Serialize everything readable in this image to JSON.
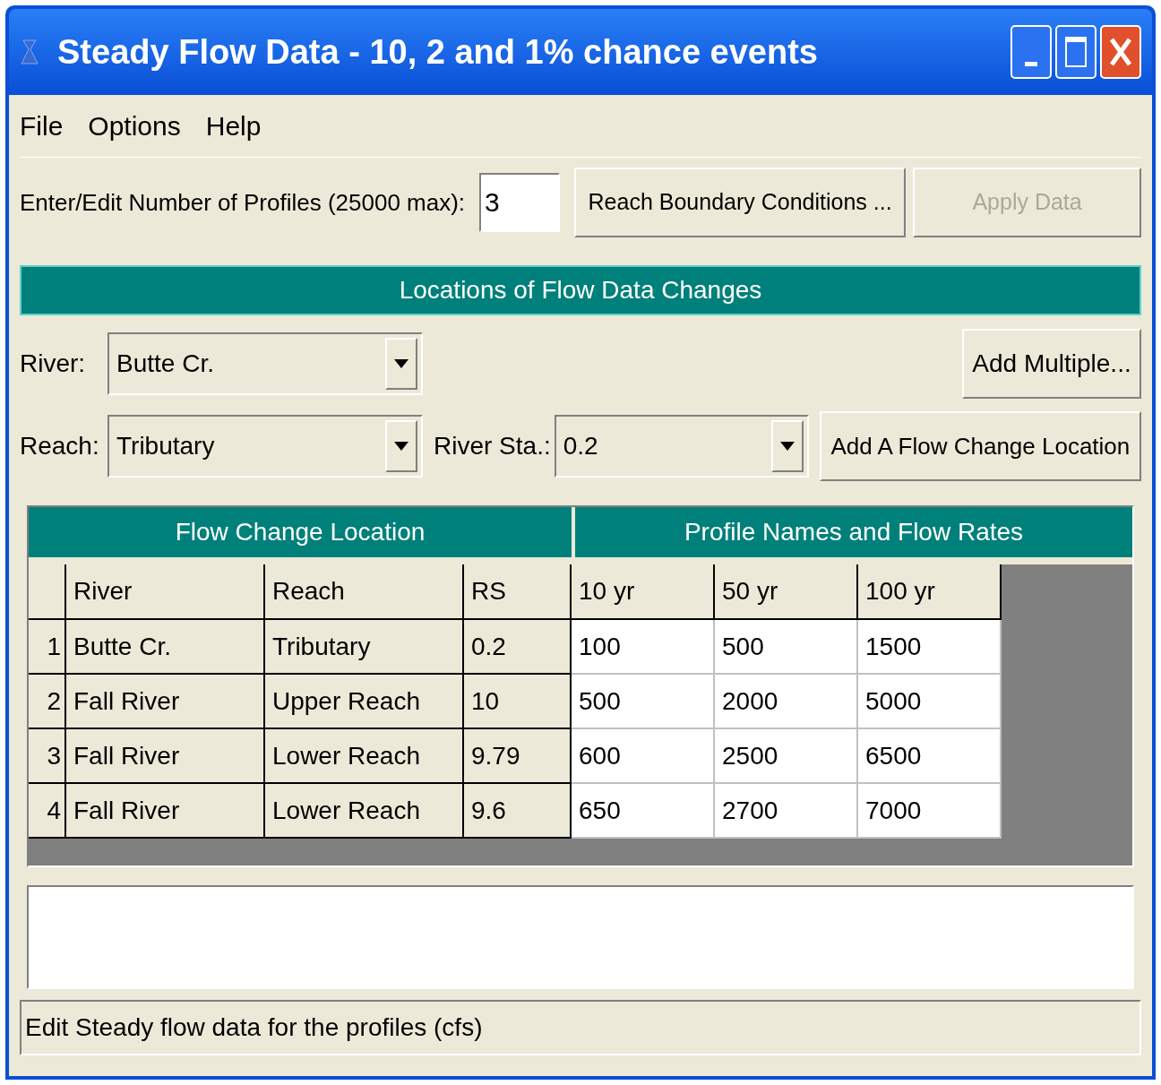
{
  "window": {
    "title": "Steady Flow Data - 10, 2 and 1% chance events"
  },
  "menu": [
    {
      "label": "File"
    },
    {
      "label": "Options"
    },
    {
      "label": "Help"
    }
  ],
  "profiles": {
    "label": "Enter/Edit Number of Profiles (25000 max):",
    "value": "3"
  },
  "buttons": [
    {
      "label": "Reach Boundary Conditions ...",
      "disabled": false
    },
    {
      "label": "Apply Data",
      "disabled": true
    }
  ],
  "locations_header": "Locations of Flow Data Changes",
  "river": {
    "label": "River:",
    "value": "Butte Cr."
  },
  "add_multiple": "Add Multiple...",
  "reach": {
    "label": "Reach:",
    "value": "Tributary"
  },
  "river_sta": {
    "label": "River Sta.:",
    "value": "0.2"
  },
  "add_location": "Add A Flow Change Location",
  "table": {
    "group_headers": [
      "Flow Change Location",
      "Profile Names and Flow Rates"
    ],
    "columns": [
      "River",
      "Reach",
      "RS",
      "10 yr",
      "50 yr",
      "100 yr"
    ],
    "rows": [
      {
        "number": "1",
        "cells": [
          "Butte Cr.",
          "Tributary",
          "0.2",
          "100",
          "500",
          "1500"
        ]
      },
      {
        "number": "2",
        "cells": [
          "Fall River",
          "Upper Reach",
          "10",
          "500",
          "2000",
          "5000"
        ]
      },
      {
        "number": "3",
        "cells": [
          "Fall River",
          "Lower Reach",
          "9.79",
          "600",
          "2500",
          "6500"
        ]
      },
      {
        "number": "4",
        "cells": [
          "Fall River",
          "Lower Reach",
          "9.6",
          "650",
          "2700",
          "7000"
        ]
      }
    ]
  },
  "status_bar": "Edit Steady flow data for the profiles (cfs)"
}
